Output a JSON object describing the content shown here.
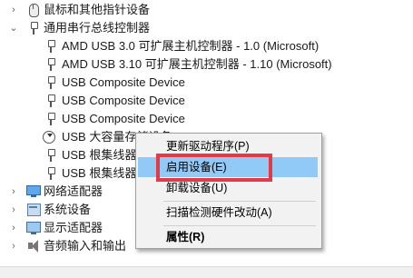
{
  "tree": {
    "mouse_group": "鼠标和其他指针设备",
    "usb_group": "通用串行总线控制器",
    "usb_items": [
      "AMD USB 3.0 可扩展主机控制器 - 1.0 (Microsoft)",
      "AMD USB 3.10 可扩展主机控制器 - 1.10 (Microsoft)",
      "USB Composite Device",
      "USB Composite Device",
      "USB Composite Device",
      "USB 大容量存储设备",
      "USB 根集线器(USB 3.0)",
      "USB 根集线器(USB 3.0)"
    ],
    "groups_after": [
      "网络适配器",
      "系统设备",
      "显示适配器",
      "音频输入和输出"
    ]
  },
  "context_menu": {
    "items": [
      "更新驱动程序(P)",
      "启用设备(E)",
      "卸载设备(U)",
      "扫描检测硬件改动(A)",
      "属性(R)"
    ],
    "highlighted_index": 1
  },
  "colors": {
    "highlight": "#91c9f7",
    "annotation_box": "#e63946"
  }
}
